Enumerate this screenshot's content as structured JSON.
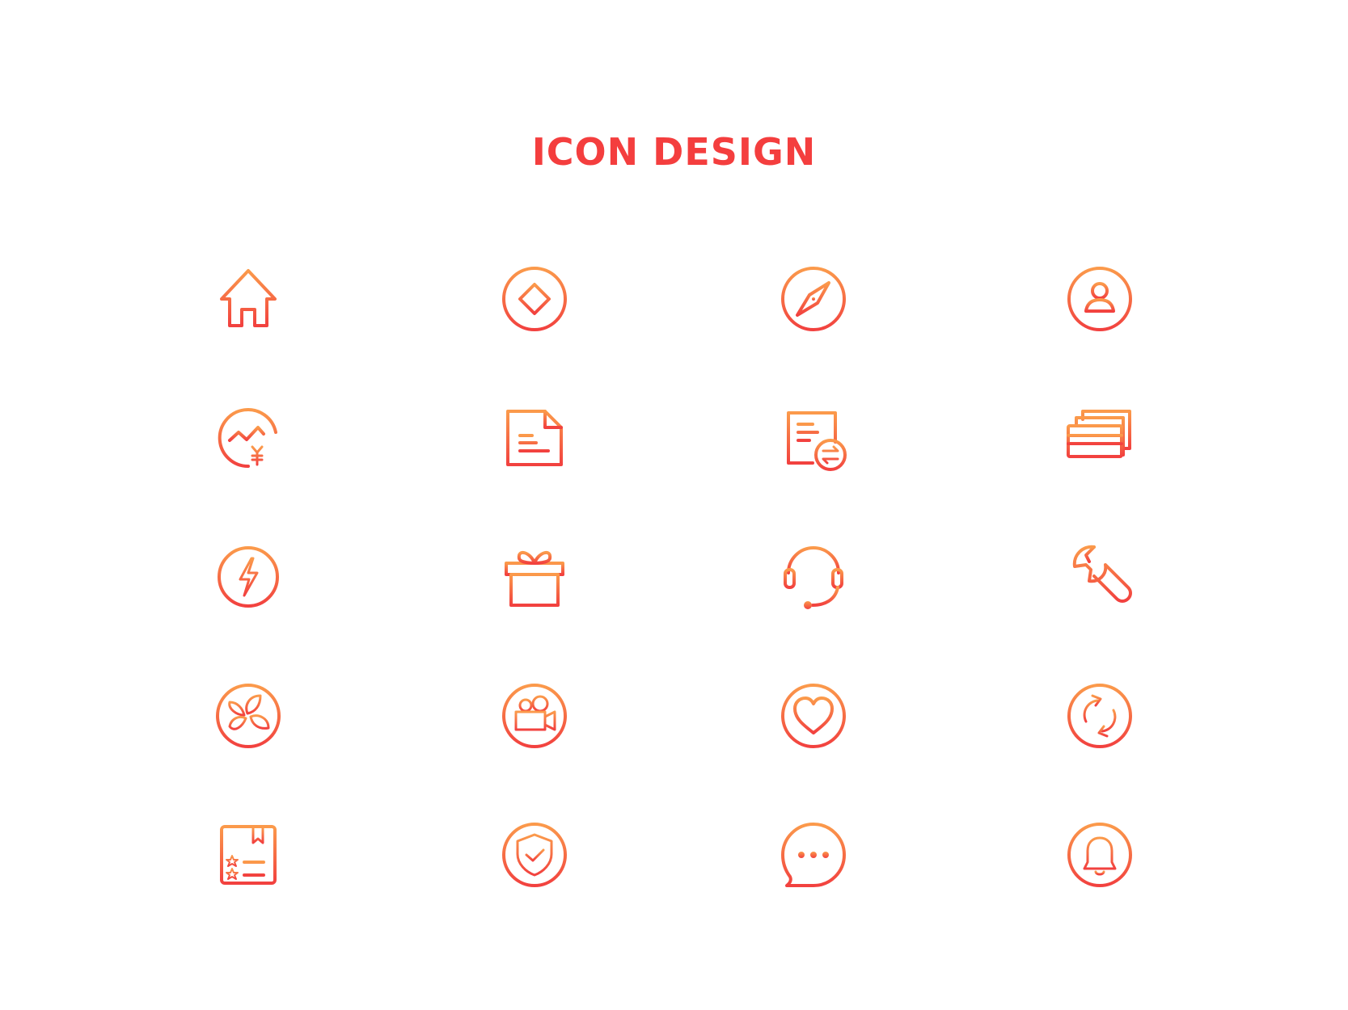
{
  "title": "ICON DESIGN",
  "colors": {
    "title": "#f43e3e",
    "gradient_start": "#fb9a4b",
    "gradient_end": "#f2413f"
  },
  "icons": [
    "home-icon",
    "diamond-icon",
    "compass-icon",
    "user-icon",
    "finance-icon",
    "document-icon",
    "transfer-icon",
    "cards-icon",
    "lightning-icon",
    "gift-icon",
    "headset-icon",
    "wrench-icon",
    "fan-icon",
    "video-camera-icon",
    "heart-icon",
    "refresh-icon",
    "rating-list-icon",
    "shield-check-icon",
    "chat-icon",
    "bell-icon"
  ]
}
